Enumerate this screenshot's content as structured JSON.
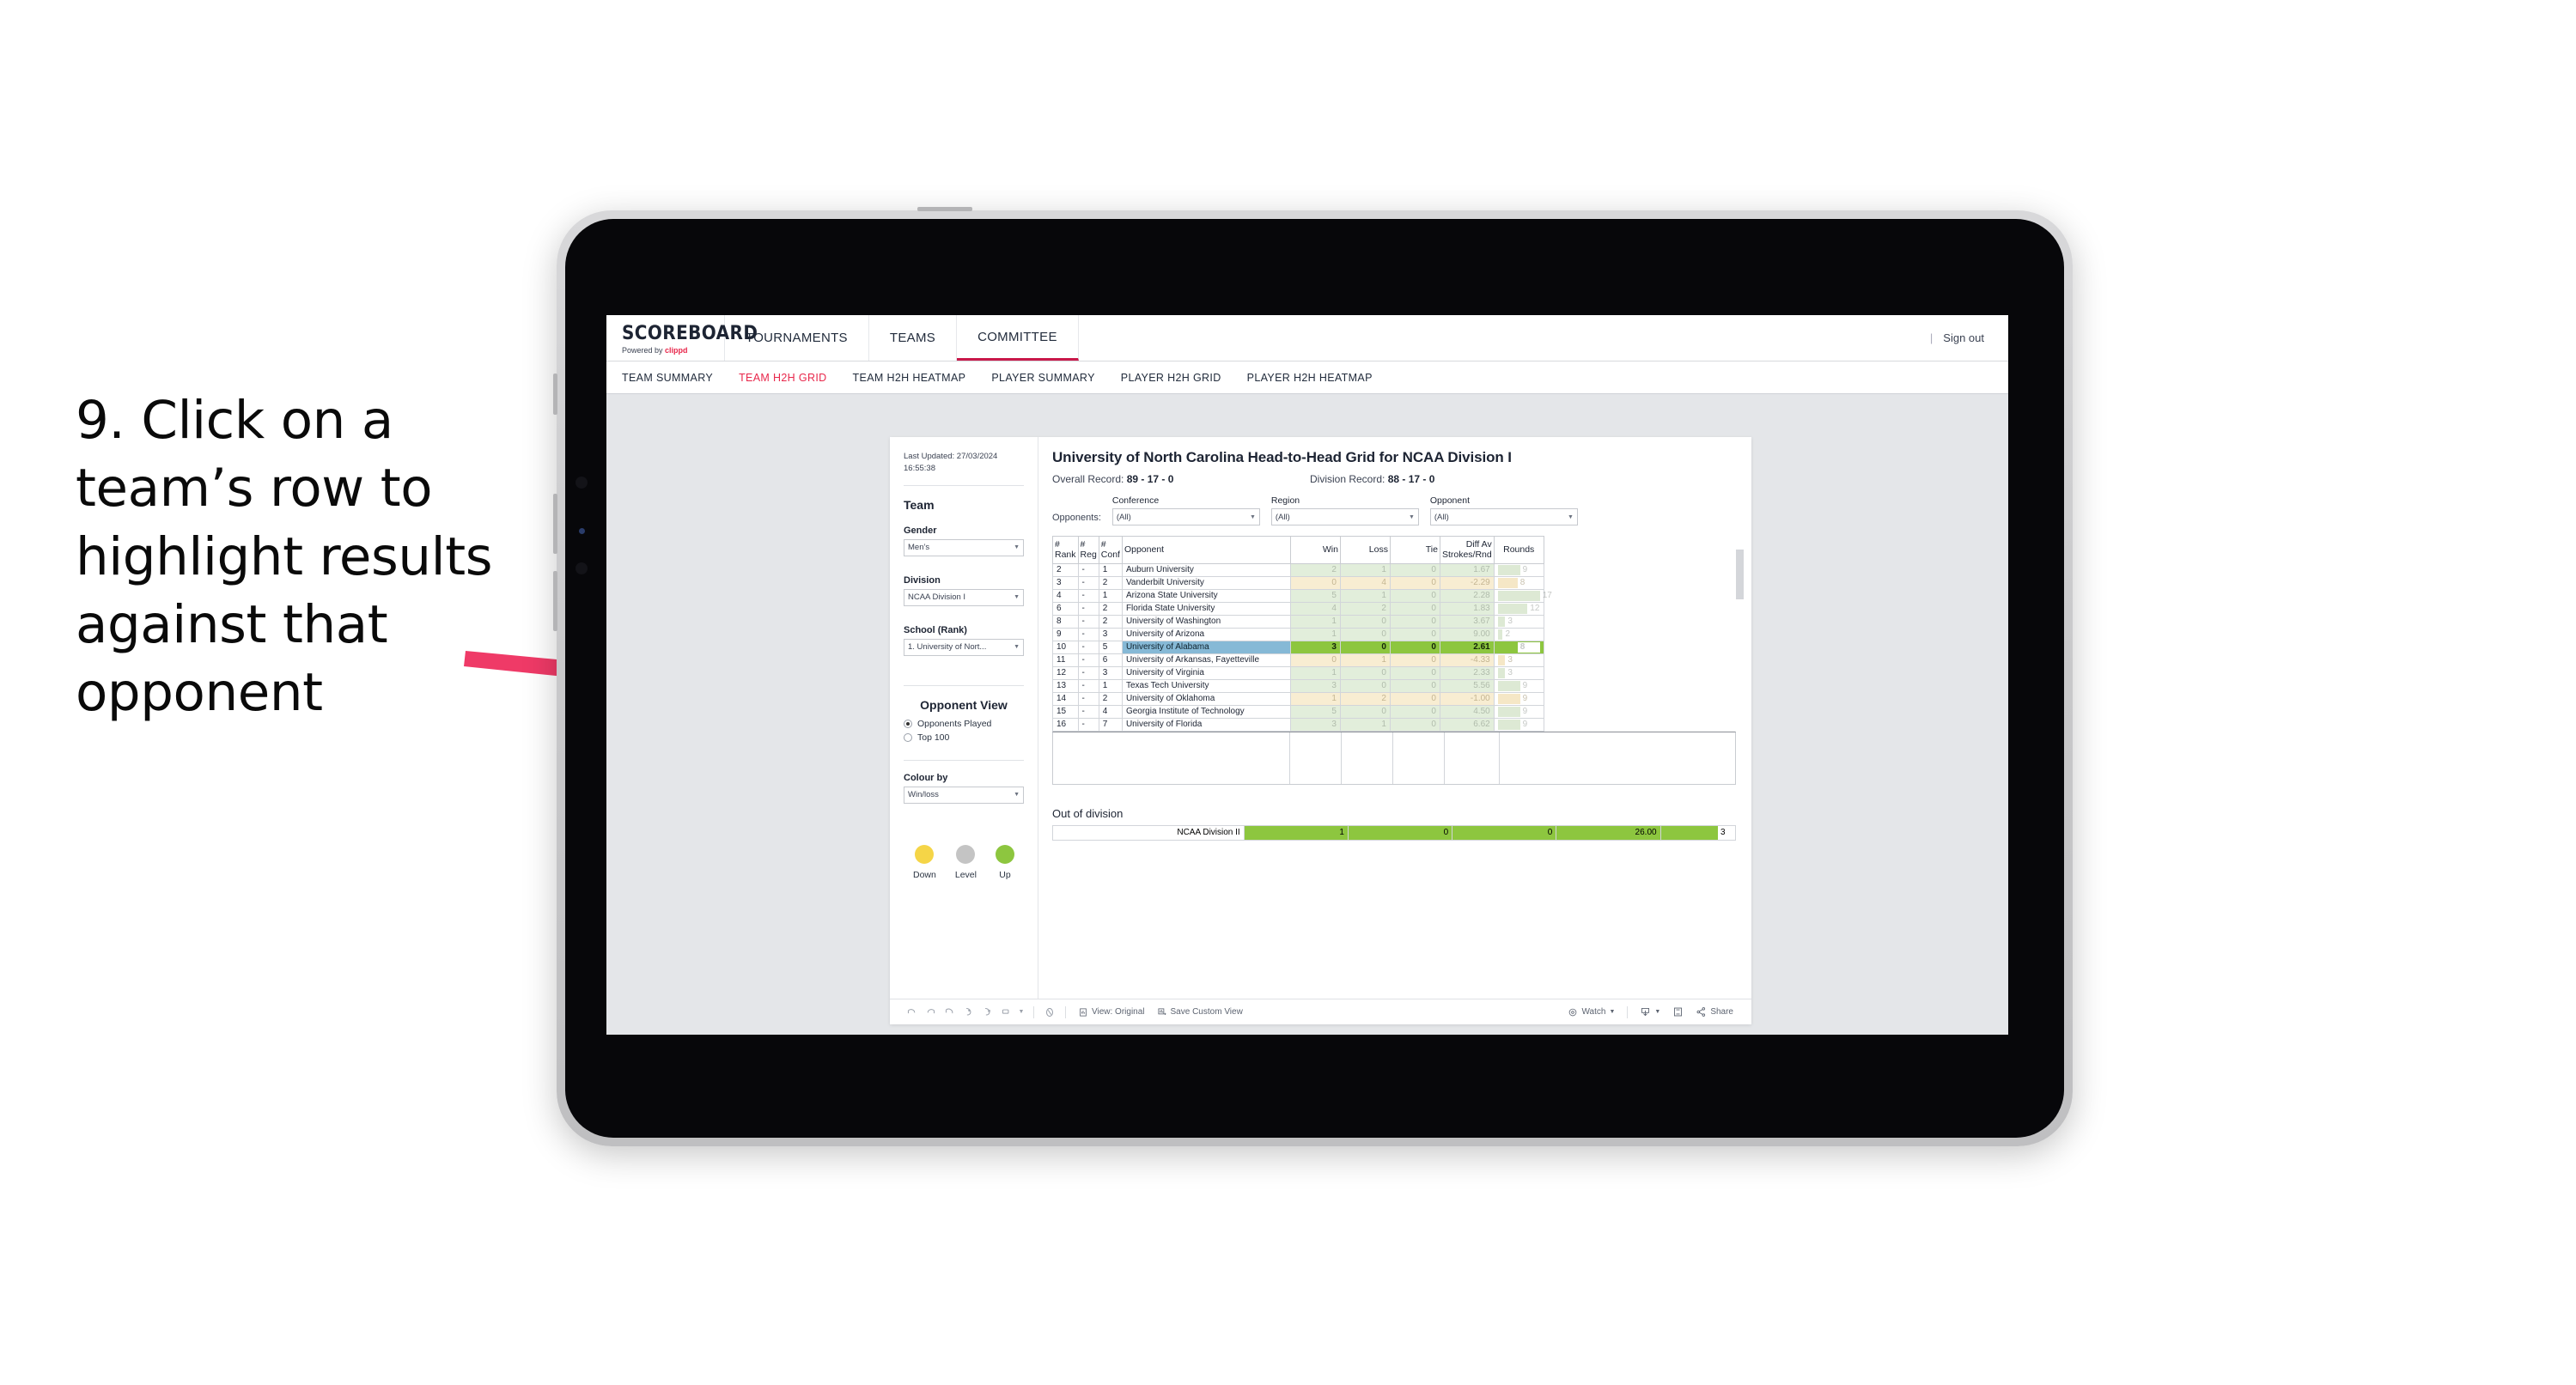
{
  "caption": "9. Click on a team’s row to highlight results against that opponent",
  "app": {
    "logo_main": "SCOREBOARD",
    "logo_sub_prefix": "Powered by ",
    "logo_sub_brand": "clippd",
    "top_nav": [
      {
        "label": "TOURNAMENTS",
        "active": false
      },
      {
        "label": "TEAMS",
        "active": false
      },
      {
        "label": "COMMITTEE",
        "active": true
      }
    ],
    "sign_out": "Sign out",
    "separator": "|",
    "sub_nav": [
      {
        "label": "TEAM SUMMARY",
        "active": false
      },
      {
        "label": "TEAM H2H GRID",
        "active": true
      },
      {
        "label": "TEAM H2H HEATMAP",
        "active": false
      },
      {
        "label": "PLAYER SUMMARY",
        "active": false
      },
      {
        "label": "PLAYER H2H GRID",
        "active": false
      },
      {
        "label": "PLAYER H2H HEATMAP",
        "active": false
      }
    ]
  },
  "rail": {
    "last_updated": "Last Updated: 27/03/2024 16:55:38",
    "team_heading": "Team",
    "filters": [
      {
        "label": "Gender",
        "value": "Men’s"
      },
      {
        "label": "Division",
        "value": "NCAA Division I"
      },
      {
        "label": "School (Rank)",
        "value": "1. University of Nort..."
      }
    ],
    "opponent_view_heading": "Opponent View",
    "opponent_view_options": [
      {
        "label": "Opponents Played",
        "selected": true
      },
      {
        "label": "Top 100",
        "selected": false
      }
    ],
    "colour_by_label": "Colour by",
    "colour_by_value": "Win/loss",
    "legend": [
      {
        "label": "Down",
        "color": "#f5d547"
      },
      {
        "label": "Level",
        "color": "#c4c4c4"
      },
      {
        "label": "Up",
        "color": "#8dc63f"
      }
    ]
  },
  "viz": {
    "title": "University of North Carolina Head-to-Head Grid for NCAA Division I",
    "overall_record_label": "Overall Record:",
    "overall_record_value": "89 - 17 - 0",
    "division_record_label": "Division Record:",
    "division_record_value": "88 - 17 - 0",
    "opponents_label": "Opponents:",
    "opponent_filters": [
      {
        "caption": "Conference",
        "value": "(All)"
      },
      {
        "caption": "Region",
        "value": "(All)"
      },
      {
        "caption": "Opponent",
        "value": "(All)"
      }
    ],
    "out_of_division_heading": "Out of division",
    "out_of_division_row": {
      "name": "NCAA Division II",
      "win": "1",
      "loss": "0",
      "tie": "0",
      "diff": "26.00",
      "rounds": "3"
    }
  },
  "chart_data": {
    "type": "table",
    "title": "University of North Carolina Head-to-Head Grid for NCAA Division I",
    "columns": [
      "# Rank",
      "# Reg",
      "# Conf",
      "Opponent",
      "Win",
      "Loss",
      "Tie",
      "Diff Av Strokes/Rnd",
      "Rounds"
    ],
    "rounds_max": 17,
    "rows": [
      {
        "rank": "2",
        "reg": "-",
        "conf": "1",
        "opponent": "Auburn University",
        "win": "2",
        "loss": "1",
        "tie": "0",
        "diff": "1.67",
        "rounds": "9",
        "tone": "up",
        "selected": false
      },
      {
        "rank": "3",
        "reg": "-",
        "conf": "2",
        "opponent": "Vanderbilt University",
        "win": "0",
        "loss": "4",
        "tie": "0",
        "diff": "-2.29",
        "rounds": "8",
        "tone": "down",
        "selected": false
      },
      {
        "rank": "4",
        "reg": "-",
        "conf": "1",
        "opponent": "Arizona State University",
        "win": "5",
        "loss": "1",
        "tie": "0",
        "diff": "2.28",
        "rounds": "17",
        "tone": "up",
        "selected": false
      },
      {
        "rank": "6",
        "reg": "-",
        "conf": "2",
        "opponent": "Florida State University",
        "win": "4",
        "loss": "2",
        "tie": "0",
        "diff": "1.83",
        "rounds": "12",
        "tone": "up",
        "selected": false
      },
      {
        "rank": "8",
        "reg": "-",
        "conf": "2",
        "opponent": "University of Washington",
        "win": "1",
        "loss": "0",
        "tie": "0",
        "diff": "3.67",
        "rounds": "3",
        "tone": "up",
        "selected": false
      },
      {
        "rank": "9",
        "reg": "-",
        "conf": "3",
        "opponent": "University of Arizona",
        "win": "1",
        "loss": "0",
        "tie": "0",
        "diff": "9.00",
        "rounds": "2",
        "tone": "up",
        "selected": false
      },
      {
        "rank": "10",
        "reg": "-",
        "conf": "5",
        "opponent": "University of Alabama",
        "win": "3",
        "loss": "0",
        "tie": "0",
        "diff": "2.61",
        "rounds": "8",
        "tone": "up",
        "selected": true
      },
      {
        "rank": "11",
        "reg": "-",
        "conf": "6",
        "opponent": "University of Arkansas, Fayetteville",
        "win": "0",
        "loss": "1",
        "tie": "0",
        "diff": "-4.33",
        "rounds": "3",
        "tone": "down",
        "selected": false
      },
      {
        "rank": "12",
        "reg": "-",
        "conf": "3",
        "opponent": "University of Virginia",
        "win": "1",
        "loss": "0",
        "tie": "0",
        "diff": "2.33",
        "rounds": "3",
        "tone": "up",
        "selected": false
      },
      {
        "rank": "13",
        "reg": "-",
        "conf": "1",
        "opponent": "Texas Tech University",
        "win": "3",
        "loss": "0",
        "tie": "0",
        "diff": "5.56",
        "rounds": "9",
        "tone": "up",
        "selected": false
      },
      {
        "rank": "14",
        "reg": "-",
        "conf": "2",
        "opponent": "University of Oklahoma",
        "win": "1",
        "loss": "2",
        "tie": "0",
        "diff": "-1.00",
        "rounds": "9",
        "tone": "down",
        "selected": false
      },
      {
        "rank": "15",
        "reg": "-",
        "conf": "4",
        "opponent": "Georgia Institute of Technology",
        "win": "5",
        "loss": "0",
        "tie": "0",
        "diff": "4.50",
        "rounds": "9",
        "tone": "up",
        "selected": false
      },
      {
        "rank": "16",
        "reg": "-",
        "conf": "7",
        "opponent": "University of Florida",
        "win": "3",
        "loss": "1",
        "tie": "0",
        "diff": "6.62",
        "rounds": "9",
        "tone": "up",
        "selected": false
      }
    ]
  },
  "toolbar": {
    "view_label": "View: Original",
    "save_label": "Save Custom View",
    "watch_label": "Watch",
    "share_label": "Share"
  }
}
